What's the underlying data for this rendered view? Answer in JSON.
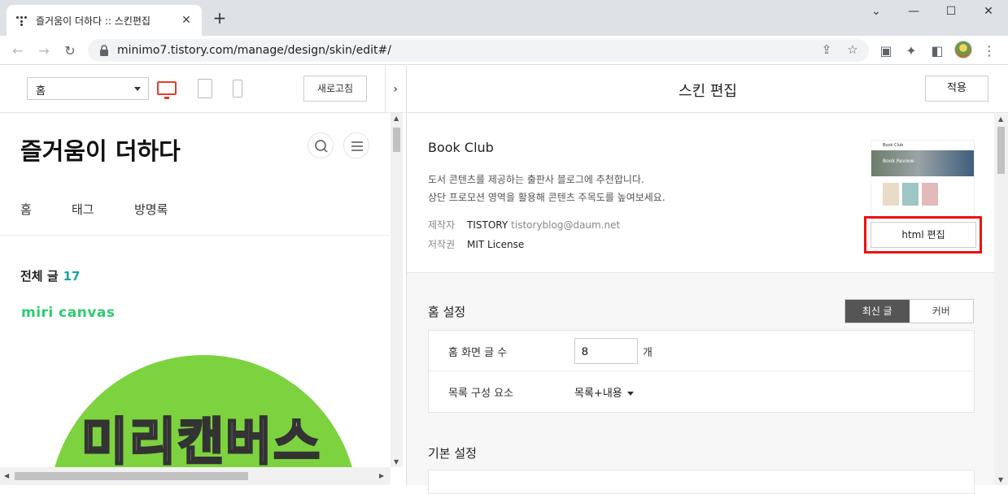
{
  "browser": {
    "tab_title": "즐거움이 더하다 :: 스킨편집",
    "url": "minimo7.tistory.com/manage/design/skin/edit#/"
  },
  "left_pane": {
    "page_select": "홈",
    "refresh_label": "새로고침",
    "blog_title": "즐거움이 더하다",
    "nav": [
      "홈",
      "태그",
      "방명록"
    ],
    "total_label": "전체 글",
    "total_count": "17",
    "brand_logo": "miri canvas",
    "banner_text": "미리캔버스"
  },
  "right_pane": {
    "title": "스킨 편집",
    "apply_label": "적용",
    "skin": {
      "name": "Book Club",
      "desc_line1": "도서 콘텐츠를 제공하는 출판사 블로그에 추천합니다.",
      "desc_line2": "상단 프로모션 영역을 활용해 콘텐츠 주목도를 높여보세요.",
      "maker_label": "제작자",
      "maker_name": "TISTORY",
      "maker_email": "tistoryblog@daum.net",
      "license_label": "저작권",
      "license_value": "MIT License",
      "thumb_hero_text": "Book Review",
      "thumb_header_text": "Book Club",
      "html_edit_label": "html 편집"
    },
    "home_settings": {
      "title": "홈 설정",
      "tab_latest": "최신 글",
      "tab_cover": "커버",
      "post_count_label": "홈 화면 글 수",
      "post_count_value": "8",
      "post_count_unit": "개",
      "list_label": "목록 구성 요소",
      "list_value": "목록+내용"
    },
    "basic_settings": {
      "title": "기본 설정"
    }
  },
  "colors": {
    "highlight": "#ee1111",
    "accent_teal": "#1aa3a3",
    "banner_green": "#7dd33f",
    "device_active": "#e0402a"
  }
}
